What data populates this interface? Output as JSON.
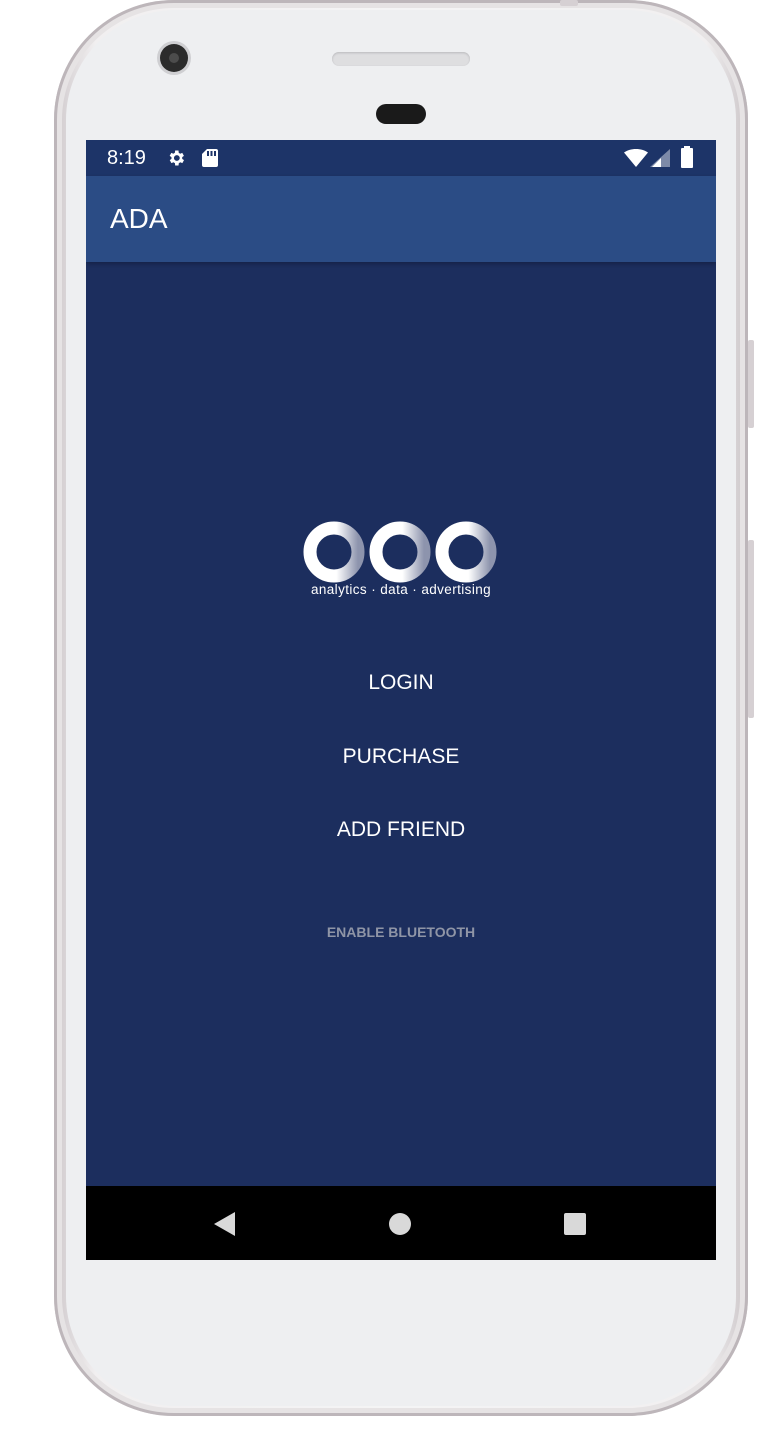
{
  "status_bar": {
    "time": "8:19",
    "left_icons": [
      "gear-icon",
      "sd-card-icon"
    ],
    "right_icons": [
      "wifi-icon",
      "cell-signal-icon",
      "battery-icon"
    ]
  },
  "app_bar": {
    "title": "ADA"
  },
  "logo": {
    "wordmark": "ada",
    "tagline": "analytics · data · advertising"
  },
  "menu": {
    "login": "LOGIN",
    "purchase": "PURCHASE",
    "add_friend": "ADD FRIEND",
    "enable_bluetooth": "ENABLE BLUETOOTH"
  },
  "nav_bar": {
    "icons": [
      "back-icon",
      "home-icon",
      "recents-icon"
    ]
  },
  "colors": {
    "screen_background": "#1c2e5e",
    "app_bar": "#2b4c85",
    "status_bar": "#1d3468",
    "disabled_text": "#8f95a6"
  }
}
